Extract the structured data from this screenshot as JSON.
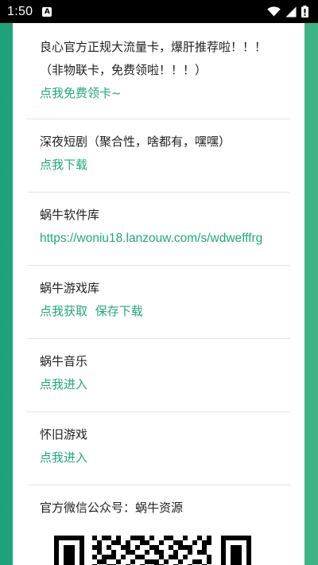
{
  "status_bar": {
    "time": "1:50",
    "notification_icon_letter": "A",
    "icons": [
      "wifi-icon",
      "signal-icon",
      "battery-icon"
    ]
  },
  "sections": [
    {
      "title_line1": "良心官方正规大流量卡，爆肝推荐啦！！！",
      "title_line2": "（非物联卡，免费领啦！！！）",
      "link": "点我免费领卡~"
    },
    {
      "title": "深夜短剧（聚合性，啥都有，嘿嘿）",
      "link": "点我下载"
    },
    {
      "title": "蜗牛软件库",
      "link": "https://woniu18.lanzouw.com/s/wdwefffrg"
    },
    {
      "title": "蜗牛游戏库",
      "link_a": "点我获取",
      "link_b": "保存下载"
    },
    {
      "title": "蜗牛音乐",
      "link": "点我进入"
    },
    {
      "title": "怀旧游戏",
      "link": "点我进入"
    },
    {
      "title": "官方微信公众号：蜗牛资源"
    }
  ],
  "colors": {
    "accent": "#22a77e",
    "background_gradient": "#1fa27c",
    "text": "#222222",
    "divider": "#e4e4e4"
  }
}
